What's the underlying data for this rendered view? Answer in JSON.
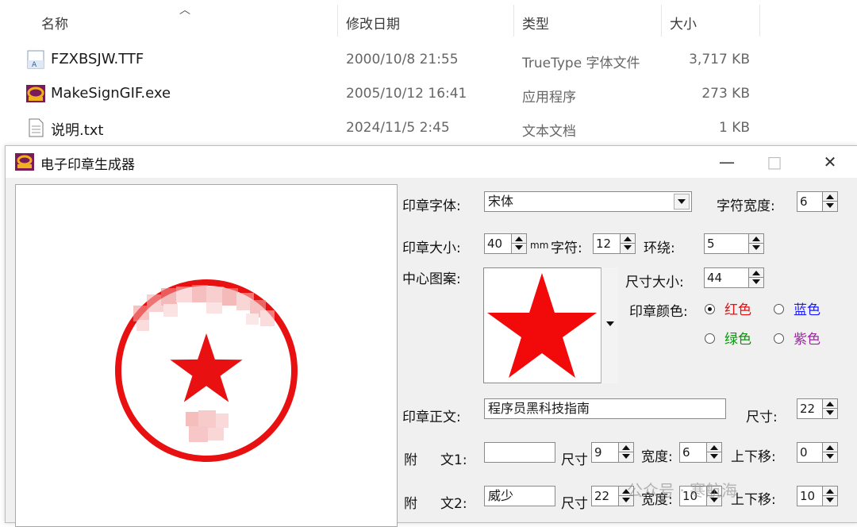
{
  "explorer": {
    "columns": {
      "name": "名称",
      "modified": "修改日期",
      "type": "类型",
      "size": "大小"
    },
    "files": [
      {
        "name": "FZXBSJW.TTF",
        "modified": "2000/10/8 21:55",
        "type": "TrueType 字体文件",
        "size": "3,717 KB",
        "icon": "font-file-icon"
      },
      {
        "name": "MakeSignGIF.exe",
        "modified": "2005/10/12 16:41",
        "type": "应用程序",
        "size": "273 KB",
        "icon": "app-exe-icon"
      },
      {
        "name": "说明.txt",
        "modified": "2024/11/5 2:45",
        "type": "文本文档",
        "size": "1 KB",
        "icon": "text-file-icon"
      }
    ]
  },
  "window": {
    "title": "电子印章生成器",
    "buttons": {
      "minimize": "—",
      "maximize": "□",
      "close": "✕"
    }
  },
  "form": {
    "font_label": "印章字体:",
    "font_value": "宋体",
    "char_width_label": "字符宽度:",
    "char_width_value": "6",
    "size_label": "印章大小:",
    "size_value": "40",
    "size_unit": "mm",
    "chars_label": "字符:",
    "chars_value": "12",
    "wrap_label": "环绕:",
    "wrap_value": "5",
    "pattern_label": "中心图案:",
    "pattern_size_label": "尺寸大小:",
    "pattern_size_value": "44",
    "color_label": "印章颜色:",
    "colors": {
      "red": {
        "label": "红色",
        "hex": "#e81010",
        "selected": true
      },
      "blue": {
        "label": "蓝色",
        "hex": "#1a1aff",
        "selected": false
      },
      "green": {
        "label": "绿色",
        "hex": "#109010",
        "selected": false
      },
      "purple": {
        "label": "紫色",
        "hex": "#9a2aa0",
        "selected": false
      }
    },
    "main_text_label": "印章正文:",
    "main_text_value": "程序员黑科技指南",
    "main_size_label": "尺寸:",
    "main_size_value": "22",
    "sub1_label_a": "附",
    "sub1_label_b": "文1:",
    "sub1_value": "",
    "sub1_size_label": "尺寸",
    "sub1_size_value": "9",
    "sub1_width_label": "宽度:",
    "sub1_width_value": "6",
    "sub1_offset_label": "上下移:",
    "sub1_offset_value": "0",
    "sub2_label_a": "附",
    "sub2_label_b": "文2:",
    "sub2_value": "威少",
    "sub2_size_label": "尺寸",
    "sub2_size_value": "22",
    "sub2_width_label": "宽度:",
    "sub2_width_value": "10",
    "sub2_offset_label": "上下移:",
    "sub2_offset_value": "10"
  },
  "watermark": "公众号 · 寒航海",
  "accent": "#e81010"
}
